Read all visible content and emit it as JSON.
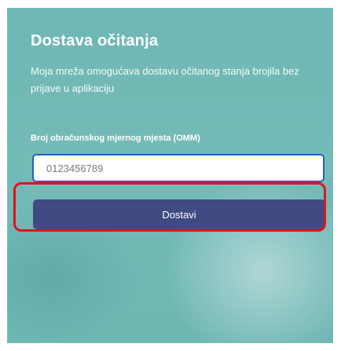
{
  "card": {
    "title": "Dostava očitanja",
    "description": "Moja mreža omogućava dostavu očitanog stanja brojila bez prijave u aplikaciju"
  },
  "form": {
    "omm_label": "Broj obračunskog mjernog mjesta (OMM)",
    "omm_value": "0123456789",
    "submit_label": "Dostavi"
  },
  "colors": {
    "card_background": "#72b9b6",
    "button_background": "#3f4b82",
    "input_border": "#1f63c6",
    "highlight_outline": "#e1131b"
  }
}
